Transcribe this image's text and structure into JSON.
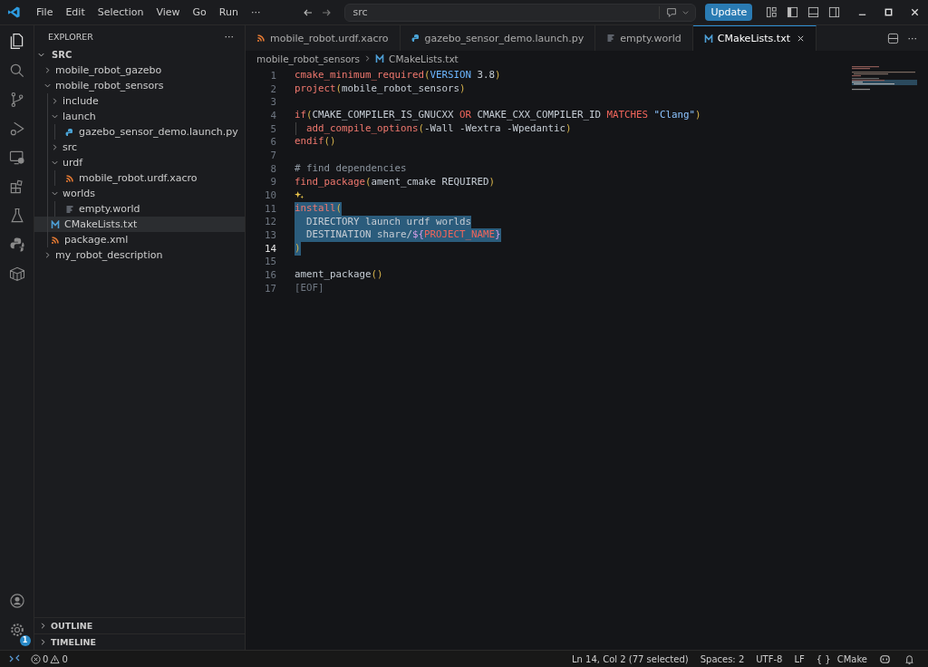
{
  "title_bar": {
    "menu": [
      "File",
      "Edit",
      "Selection",
      "View",
      "Go",
      "Run",
      "···"
    ],
    "search": {
      "value": "src"
    },
    "update_button": "Update"
  },
  "activity_bar": {
    "settings_badge": "1"
  },
  "explorer": {
    "title": "EXPLORER",
    "more": "···",
    "root": {
      "label": "SRC",
      "expanded": true
    },
    "tree": [
      {
        "label": "mobile_robot_gazebo",
        "kind": "folder",
        "expanded": false
      },
      {
        "label": "mobile_robot_sensors",
        "kind": "folder",
        "expanded": true,
        "children": [
          {
            "label": "include",
            "kind": "folder",
            "expanded": false
          },
          {
            "label": "launch",
            "kind": "folder",
            "expanded": true,
            "children": [
              {
                "label": "gazebo_sensor_demo.launch.py",
                "kind": "python",
                "selected": false
              }
            ]
          },
          {
            "label": "src",
            "kind": "folder",
            "expanded": false
          },
          {
            "label": "urdf",
            "kind": "folder",
            "expanded": true,
            "children": [
              {
                "label": "mobile_robot.urdf.xacro",
                "kind": "xml",
                "selected": false
              }
            ]
          },
          {
            "label": "worlds",
            "kind": "folder",
            "expanded": true,
            "children": [
              {
                "label": "empty.world",
                "kind": "text",
                "selected": false
              }
            ]
          },
          {
            "label": "CMakeLists.txt",
            "kind": "cmake",
            "selected": true
          },
          {
            "label": "package.xml",
            "kind": "xml",
            "selected": false
          }
        ]
      },
      {
        "label": "my_robot_description",
        "kind": "folder",
        "expanded": false
      }
    ]
  },
  "panels": [
    {
      "label": "OUTLINE",
      "expanded": false
    },
    {
      "label": "TIMELINE",
      "expanded": false
    }
  ],
  "tabs": [
    {
      "label": "mobile_robot.urdf.xacro",
      "kind": "xml",
      "selected": false
    },
    {
      "label": "gazebo_sensor_demo.launch.py",
      "kind": "python",
      "selected": false
    },
    {
      "label": "empty.world",
      "kind": "text",
      "selected": false
    },
    {
      "label": "CMakeLists.txt",
      "kind": "cmake",
      "selected": true
    }
  ],
  "tab_more": "···",
  "breadcrumb": [
    {
      "label": "mobile_robot_sensors",
      "kind": "folder"
    },
    {
      "label": "CMakeLists.txt",
      "kind": "cmake"
    }
  ],
  "editor": {
    "lines": [
      {
        "number": "1",
        "selected": false,
        "current": false,
        "tokens": [
          {
            "text": "cmake_minimum_required",
            "kind": "fn"
          },
          {
            "text": "(",
            "kind": "paren"
          },
          {
            "text": "VERSION",
            "kind": "kw"
          },
          {
            "text": " 3.8",
            "kind": "plain"
          },
          {
            "text": ")",
            "kind": "paren"
          }
        ]
      },
      {
        "number": "2",
        "selected": false,
        "current": false,
        "tokens": [
          {
            "text": "project",
            "kind": "fn"
          },
          {
            "text": "(",
            "kind": "paren"
          },
          {
            "text": "mobile_robot_sensors",
            "kind": "plain"
          },
          {
            "text": ")",
            "kind": "paren"
          }
        ]
      },
      {
        "number": "3",
        "selected": false,
        "current": false
      },
      {
        "number": "4",
        "selected": false,
        "current": false,
        "tokens": [
          {
            "text": "if",
            "kind": "fn"
          },
          {
            "text": "(",
            "kind": "paren"
          },
          {
            "text": "CMAKE_COMPILER_IS_GNUCXX ",
            "kind": "plain"
          },
          {
            "text": "OR",
            "kind": "op"
          },
          {
            "text": " CMAKE_CXX_COMPILER_ID ",
            "kind": "plain"
          },
          {
            "text": "MATCHES",
            "kind": "op"
          },
          {
            "text": " \"Clang\"",
            "kind": "string"
          },
          {
            "text": ")",
            "kind": "paren"
          }
        ]
      },
      {
        "number": "5",
        "selected": false,
        "current": false,
        "tokens": [
          {
            "text": "  add_compile_options",
            "kind": "fn"
          },
          {
            "text": "(",
            "kind": "paren"
          },
          {
            "text": "-Wall -Wextra -Wpedantic",
            "kind": "plain"
          },
          {
            "text": ")",
            "kind": "paren"
          }
        ]
      },
      {
        "number": "6",
        "selected": false,
        "current": false,
        "tokens": [
          {
            "text": "endif",
            "kind": "fn"
          },
          {
            "text": "()",
            "kind": "paren"
          }
        ]
      },
      {
        "number": "7",
        "selected": false,
        "current": false
      },
      {
        "number": "8",
        "selected": false,
        "current": false,
        "tokens": [
          {
            "text": "# find dependencies",
            "kind": "comment"
          }
        ]
      },
      {
        "number": "9",
        "selected": false,
        "current": false,
        "tokens": [
          {
            "text": "find_package",
            "kind": "fn"
          },
          {
            "text": "(",
            "kind": "paren"
          },
          {
            "text": "ament_cmake REQUIRED",
            "kind": "plain"
          },
          {
            "text": ")",
            "kind": "paren"
          }
        ]
      },
      {
        "number": "10",
        "selected": false,
        "current": false,
        "sparkle": true
      },
      {
        "number": "11",
        "selected": true,
        "current": false,
        "tokens": [
          {
            "text": "install",
            "kind": "fn"
          },
          {
            "text": "(",
            "kind": "paren"
          }
        ]
      },
      {
        "number": "12",
        "selected": true,
        "current": false,
        "tokens": [
          {
            "text": "  DIRECTORY launch urdf worlds",
            "kind": "plain"
          }
        ]
      },
      {
        "number": "13",
        "selected": true,
        "current": false,
        "tokens": [
          {
            "text": "  DESTINATION share/",
            "kind": "plain"
          },
          {
            "text": "${",
            "kind": "var"
          },
          {
            "text": "PROJECT_NAME",
            "kind": "op"
          },
          {
            "text": "}",
            "kind": "var"
          }
        ]
      },
      {
        "number": "14",
        "selected": true,
        "current": true,
        "tokens": [
          {
            "text": ")",
            "kind": "paren"
          }
        ]
      },
      {
        "number": "15",
        "selected": false,
        "current": false
      },
      {
        "number": "16",
        "selected": false,
        "current": false,
        "tokens": [
          {
            "text": "ament_package",
            "kind": "plain"
          },
          {
            "text": "()",
            "kind": "paren"
          }
        ]
      },
      {
        "number": "17",
        "selected": false,
        "current": false,
        "tokens": [
          {
            "text": "[EOF]",
            "kind": "eof"
          }
        ]
      }
    ]
  },
  "status_bar": {
    "errors": "0",
    "warnings": "0",
    "items": [
      "Ln 14, Col 2 (77 selected)",
      "Spaces: 2",
      "UTF-8",
      "LF"
    ],
    "language": {
      "icon": "{ }",
      "label": "CMake"
    }
  }
}
